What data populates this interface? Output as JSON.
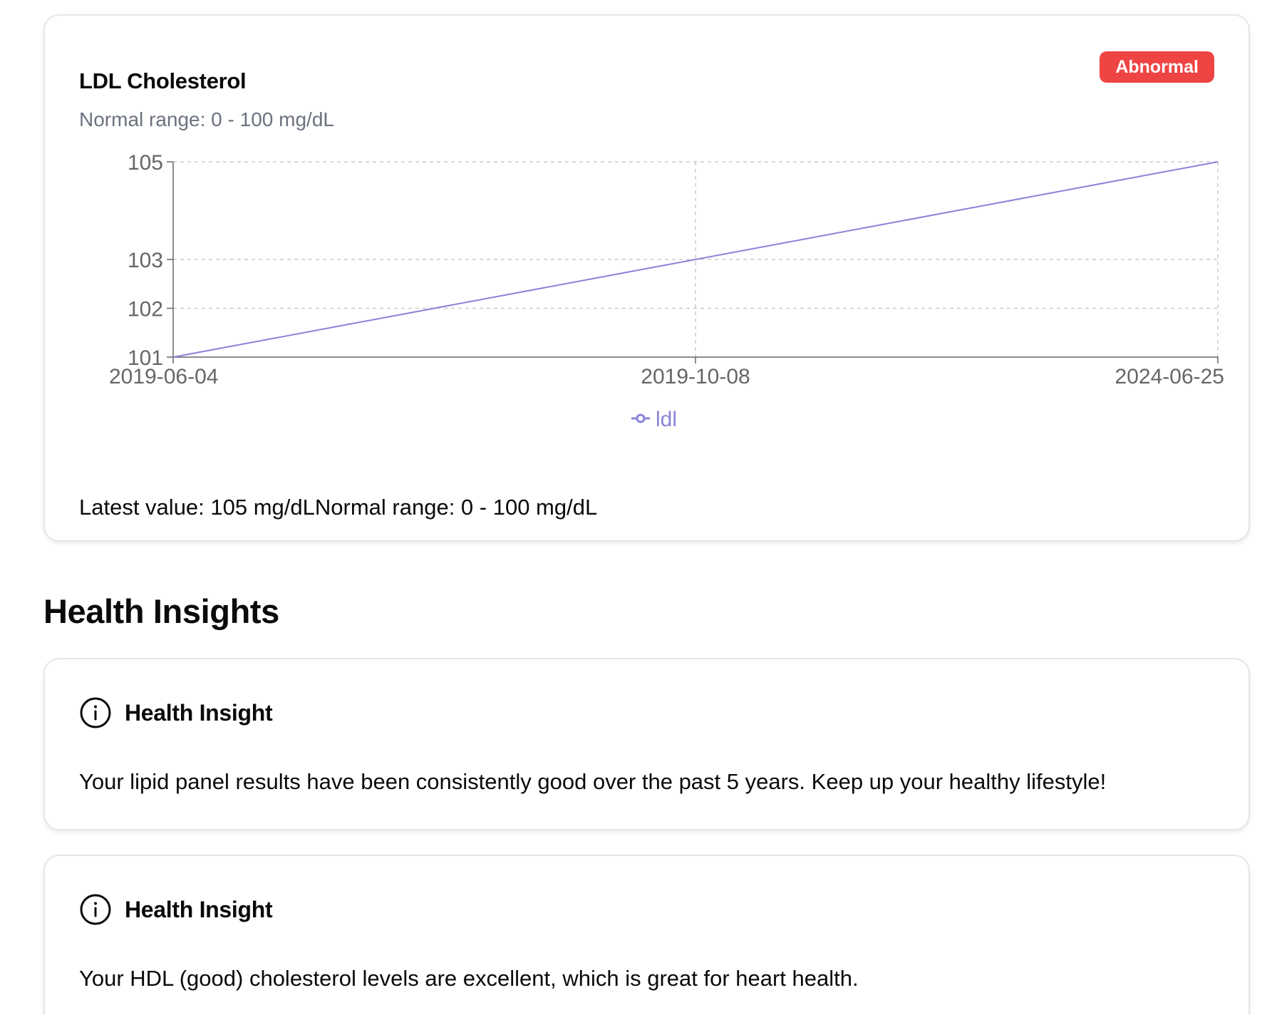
{
  "chart_card": {
    "title": "LDL Cholesterol",
    "subtitle": "Normal range: 0 - 100 mg/dL",
    "badge": "Abnormal",
    "badge_color": "#ef4444",
    "footer_latest": "Latest value: 105 mg/dL",
    "footer_range": "Normal range: 0 - 100 mg/dL"
  },
  "chart_data": {
    "type": "line",
    "x": [
      "2019-06-04",
      "2019-10-08",
      "2024-06-25"
    ],
    "series": [
      {
        "name": "ldl",
        "values": [
          101,
          103,
          105
        ],
        "color": "#8884d8"
      }
    ],
    "y_ticks": [
      101,
      102,
      103,
      105
    ],
    "ylim": [
      101,
      105
    ],
    "grid": true,
    "legend": "bottom"
  },
  "insights": {
    "heading": "Health Insights",
    "items": [
      {
        "title": "Health Insight",
        "icon": "info-icon",
        "text": "Your lipid panel results have been consistently good over the past 5 years. Keep up your healthy lifestyle!"
      },
      {
        "title": "Health Insight",
        "icon": "info-icon",
        "text": "Your HDL (good) cholesterol levels are excellent, which is great for heart health."
      }
    ]
  }
}
